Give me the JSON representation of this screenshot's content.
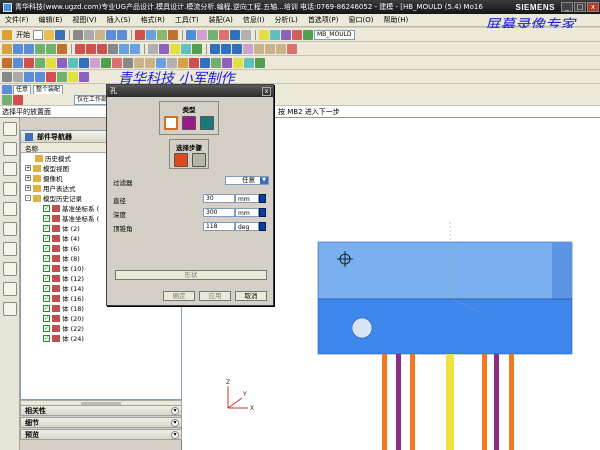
{
  "titlebar": {
    "title": "青华科技(www.ugzd.com)专业UG产品设计.模具设计.模流分析.编程.逆向工程.五轴...培训 电话:0769-86246052 - 建模 - [HB_MOULD (5.4) Mo16",
    "brand": "SIEMENS",
    "min": "_",
    "max": "□",
    "close": "x"
  },
  "menubar": [
    "文件(F)",
    "编辑(E)",
    "视图(V)",
    "插入(S)",
    "格式(R)",
    "工具(T)",
    "装配(A)",
    "信息(I)",
    "分析(L)",
    "首选项(P)",
    "窗口(O)",
    "帮助(H)"
  ],
  "toolbar1": {
    "start": "开始",
    "dropdown": "MB_MOULD"
  },
  "toolbar3": {
    "filter": "任意",
    "assembly": "整个装配",
    "workpart": "仅在工作部件"
  },
  "watermarks": {
    "top": "屏幕录像专家",
    "mid": "青华科技  小军制作"
  },
  "status": {
    "left": "选择平的放置面",
    "right": "按 MB2 进入下一步"
  },
  "navigator": {
    "title": "部件导航器",
    "col_name": "名称",
    "items": [
      {
        "label": "历史模式",
        "level": 0
      },
      {
        "label": "模型视图",
        "level": 0,
        "expand": "+"
      },
      {
        "label": "摄像机",
        "level": 0,
        "expand": "+"
      },
      {
        "label": "用户表达式",
        "level": 0,
        "expand": "+"
      },
      {
        "label": "模型历史记录",
        "level": 0,
        "expand": "-"
      },
      {
        "label": "基准坐标系 (",
        "level": 1
      },
      {
        "label": "基准坐标系 (",
        "level": 1
      },
      {
        "label": "体 (2)",
        "level": 1
      },
      {
        "label": "体 (4)",
        "level": 1
      },
      {
        "label": "体 (6)",
        "level": 1
      },
      {
        "label": "体 (8)",
        "level": 1
      },
      {
        "label": "体 (10)",
        "level": 1
      },
      {
        "label": "体 (12)",
        "level": 1
      },
      {
        "label": "体 (14)",
        "level": 1
      },
      {
        "label": "体 (16)",
        "level": 1
      },
      {
        "label": "体 (18)",
        "level": 1
      },
      {
        "label": "体 (20)",
        "level": 1
      },
      {
        "label": "体 (22)",
        "level": 1
      },
      {
        "label": "体 (24)",
        "level": 1
      }
    ],
    "sections": [
      "相关性",
      "细节",
      "预览"
    ]
  },
  "dialog": {
    "title": "孔",
    "type_label": "类型",
    "steps_label": "选择步骤",
    "filter_label": "过滤器",
    "filter_value": "任意",
    "params": [
      {
        "label": "直径",
        "value": "30",
        "unit": "mm"
      },
      {
        "label": "深度",
        "value": "300",
        "unit": "mm"
      },
      {
        "label": "顶锥角",
        "value": "118",
        "unit": "deg"
      }
    ],
    "btn_section": "形状",
    "btn_ok": "确定",
    "btn_apply": "应用",
    "btn_cancel": "取消"
  },
  "viewport": {
    "axis_x": "X",
    "axis_y": "Y",
    "axis_z": "Z",
    "colors": {
      "block_top": "#7ab0f0",
      "block_bottom": "#3d86ec",
      "pin_orange": "#f07b1e",
      "pin_purple": "#8c2f80",
      "pin_yellow": "#f0e040"
    }
  }
}
